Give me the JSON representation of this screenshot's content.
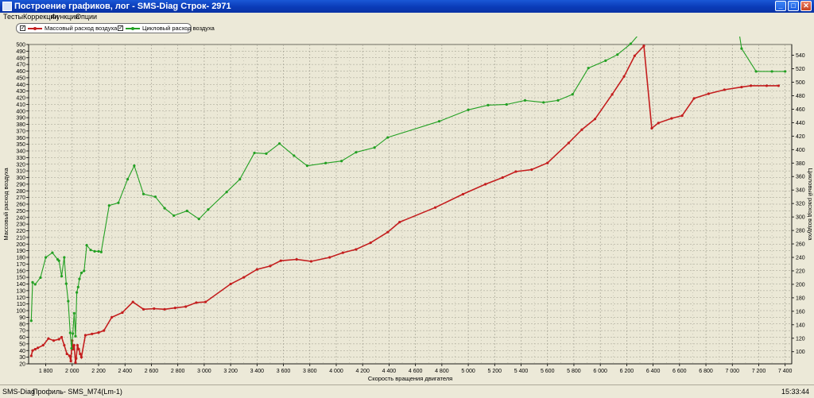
{
  "window": {
    "title": "Построение графиков, лог - SMS-Diag Строк- 2971",
    "minimize_glyph": "_",
    "maximize_glyph": "□",
    "close_glyph": "✕",
    "icon": "app-icon"
  },
  "menu": {
    "items": [
      "Тесты",
      "Коррекции",
      "Функции",
      "Опции"
    ]
  },
  "legend": {
    "check_glyph": "✓",
    "series1_label": "Массовый расход воздуха",
    "series2_label": "Цикловый расход воздуха"
  },
  "status": {
    "app": "SMS-Diag",
    "profile": "Профиль- SMS_M74(Lm-1)",
    "time": "15:33:44"
  },
  "colors": {
    "mass": "#c41e1e",
    "cycle": "#22a022",
    "plot_bg": "#ebe8d6",
    "grid": "#9c9a8c"
  },
  "chart_data": {
    "type": "line",
    "xlabel": "Скорость вращения двигателя",
    "ylabel": "Массовый расход воздуха",
    "y2label": "Цикловый расход воздуха",
    "xlim": [
      1670,
      7450
    ],
    "ylim": [
      20,
      500
    ],
    "y2lim": [
      82,
      556
    ],
    "x_ticks": [
      1800,
      2000,
      2200,
      2400,
      2600,
      2800,
      3000,
      3200,
      3400,
      3600,
      3800,
      4000,
      4200,
      4400,
      4600,
      4800,
      5000,
      5200,
      5400,
      5600,
      5800,
      6000,
      6200,
      6400,
      6600,
      6800,
      7000,
      7200,
      7400
    ],
    "x_tick_labels": [
      "1 800",
      "2 000",
      "2 200",
      "2 400",
      "2 600",
      "2 800",
      "3 000",
      "3 200",
      "3 400",
      "3 600",
      "3 800",
      "4 000",
      "4 200",
      "4 400",
      "4 600",
      "4 800",
      "5 000",
      "5 200",
      "5 400",
      "5 600",
      "5 800",
      "6 000",
      "6 200",
      "6 400",
      "6 600",
      "6 800",
      "7 000",
      "7 200",
      "7 400"
    ],
    "y_ticks": [
      20,
      30,
      40,
      50,
      60,
      70,
      80,
      90,
      100,
      110,
      120,
      130,
      140,
      150,
      160,
      170,
      180,
      190,
      200,
      210,
      220,
      230,
      240,
      250,
      260,
      270,
      280,
      290,
      300,
      310,
      320,
      330,
      340,
      350,
      360,
      370,
      380,
      390,
      400,
      410,
      420,
      430,
      440,
      450,
      460,
      470,
      480,
      490,
      500
    ],
    "y2_ticks": [
      100,
      120,
      140,
      160,
      180,
      200,
      220,
      240,
      260,
      280,
      300,
      320,
      340,
      360,
      380,
      400,
      420,
      440,
      460,
      480,
      500,
      520,
      540,
      560,
      580,
      600,
      620,
      640,
      660,
      680,
      700,
      720,
      740,
      760,
      780,
      800
    ],
    "grid": true,
    "series": [
      {
        "name": "Массовый расход воздуха",
        "axis": "left",
        "color": "#c41e1e",
        "x": [
          1690,
          1700,
          1720,
          1740,
          1780,
          1820,
          1860,
          1900,
          1920,
          1940,
          1960,
          1980,
          1990,
          2000,
          2005,
          2015,
          2025,
          2030,
          2040,
          2050,
          2060,
          2070,
          2100,
          2150,
          2200,
          2240,
          2300,
          2380,
          2460,
          2540,
          2620,
          2700,
          2780,
          2860,
          2940,
          3010,
          3200,
          3300,
          3400,
          3500,
          3580,
          3700,
          3810,
          3950,
          4050,
          4150,
          4260,
          4390,
          4480,
          4750,
          4960,
          5130,
          5260,
          5360,
          5480,
          5600,
          5760,
          5860,
          5960,
          6090,
          6180,
          6260,
          6330,
          6390,
          6440,
          6540,
          6620,
          6710,
          6820,
          6940,
          7070,
          7140,
          7260,
          7350
        ],
        "y": [
          32,
          40,
          42,
          44,
          48,
          58,
          55,
          57,
          60,
          48,
          35,
          32,
          24,
          55,
          42,
          48,
          22,
          28,
          48,
          42,
          35,
          30,
          63,
          65,
          67,
          70,
          90,
          97,
          113,
          102,
          103,
          102,
          104,
          106,
          112,
          113,
          140,
          150,
          162,
          167,
          175,
          177,
          174,
          180,
          187,
          192,
          202,
          218,
          233,
          255,
          275,
          290,
          300,
          309,
          312,
          322,
          352,
          372,
          388,
          425,
          452,
          483,
          498,
          374,
          382,
          389,
          393,
          419,
          426,
          432,
          436,
          438,
          438,
          438
        ]
      },
      {
        "name": "Цикловый расход воздуха",
        "axis": "right",
        "color": "#22a022",
        "x": [
          1690,
          1700,
          1720,
          1760,
          1800,
          1850,
          1890,
          1900,
          1920,
          1940,
          1955,
          1970,
          1985,
          1995,
          2005,
          2015,
          2025,
          2035,
          2045,
          2055,
          2070,
          2090,
          2110,
          2140,
          2170,
          2200,
          2220,
          2280,
          2350,
          2420,
          2470,
          2540,
          2630,
          2700,
          2770,
          2870,
          2960,
          3030,
          3170,
          3270,
          3380,
          3470,
          3570,
          3680,
          3780,
          3920,
          4040,
          4150,
          4290,
          4390,
          4780,
          5000,
          5150,
          5290,
          5430,
          5570,
          5680,
          5790,
          5910,
          6040,
          6130,
          6230,
          6340,
          6400,
          6500,
          6620,
          6710,
          6820,
          6960,
          7070,
          7180,
          7300,
          7400
        ],
        "y": [
          146,
          203,
          200,
          210,
          240,
          247,
          237,
          235,
          212,
          240,
          201,
          175,
          128,
          105,
          127,
          157,
          123,
          188,
          196,
          208,
          217,
          220,
          258,
          251,
          249,
          249,
          248,
          317,
          321,
          356,
          376,
          334,
          330,
          313,
          302,
          309,
          297,
          311,
          337,
          356,
          395,
          394,
          409,
          391,
          376,
          380,
          383,
          396,
          403,
          418,
          442,
          459,
          466,
          467,
          473,
          470,
          473,
          482,
          521,
          532,
          541,
          557,
          582,
          581,
          617,
          628,
          662,
          671,
          690,
          550,
          516,
          516,
          516
        ]
      }
    ]
  }
}
